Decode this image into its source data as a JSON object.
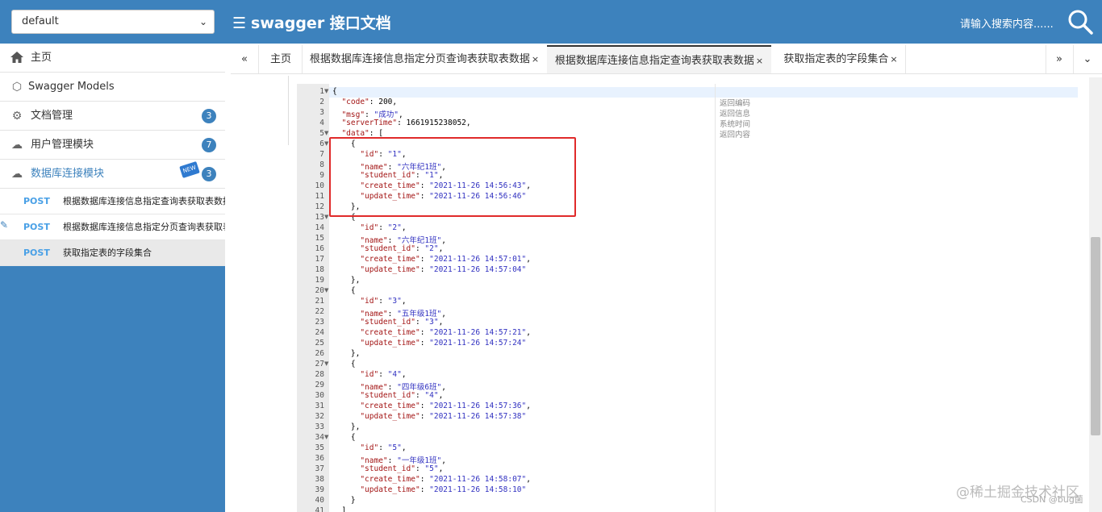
{
  "header": {
    "group_select": "default",
    "title": "swagger 接口文档",
    "search_placeholder": "请输入搜索内容......"
  },
  "sidebar": {
    "items": [
      {
        "label": "主页",
        "icon": "home-icon"
      },
      {
        "label": "Swagger Models",
        "icon": "cube-icon"
      },
      {
        "label": "文档管理",
        "icon": "doc-settings-icon",
        "badge": "3"
      },
      {
        "label": "用户管理模块",
        "icon": "cloud-icon",
        "badge": "7"
      },
      {
        "label": "数据库连接模块",
        "icon": "cloud-icon",
        "badge": "3",
        "tag": "NEW"
      }
    ],
    "apis": [
      {
        "method": "POST",
        "label": "根据数据库连接信息指定查询表获取表数据"
      },
      {
        "method": "POST",
        "label": "根据数据库连接信息指定分页查询表获取表数据"
      },
      {
        "method": "POST",
        "label": "获取指定表的字段集合"
      }
    ]
  },
  "tabs": {
    "home": "主页",
    "items": [
      {
        "label": "根据数据库连接信息指定分页查询表获取表数据"
      },
      {
        "label": "根据数据库连接信息指定查询表获取表数据"
      },
      {
        "label": "获取指定表的字段集合"
      }
    ],
    "close": "×"
  },
  "editor": {
    "lines": [
      "{",
      "  \"code\": 200,",
      "  \"msg\": \"成功\",",
      "  \"serverTime\": 1661915238052,",
      "  \"data\": [",
      "    {",
      "      \"id\": \"1\",",
      "      \"name\": \"六年纪1班\",",
      "      \"student_id\": \"1\",",
      "      \"create_time\": \"2021-11-26 14:56:43\",",
      "      \"update_time\": \"2021-11-26 14:56:46\"",
      "    },",
      "    {",
      "      \"id\": \"2\",",
      "      \"name\": \"六年纪1班\",",
      "      \"student_id\": \"2\",",
      "      \"create_time\": \"2021-11-26 14:57:01\",",
      "      \"update_time\": \"2021-11-26 14:57:04\"",
      "    },",
      "    {",
      "      \"id\": \"3\",",
      "      \"name\": \"五年级1班\",",
      "      \"student_id\": \"3\",",
      "      \"create_time\": \"2021-11-26 14:57:21\",",
      "      \"update_time\": \"2021-11-26 14:57:24\"",
      "    },",
      "    {",
      "      \"id\": \"4\",",
      "      \"name\": \"四年级6班\",",
      "      \"student_id\": \"4\",",
      "      \"create_time\": \"2021-11-26 14:57:36\",",
      "      \"update_time\": \"2021-11-26 14:57:38\"",
      "    },",
      "    {",
      "      \"id\": \"5\",",
      "      \"name\": \"一年级1班\",",
      "      \"student_id\": \"5\",",
      "      \"create_time\": \"2021-11-26 14:58:07\",",
      "      \"update_time\": \"2021-11-26 14:58:10\"",
      "    }",
      "  ]"
    ],
    "fold_lines": [
      1,
      5,
      6,
      13,
      20,
      27,
      34
    ],
    "descriptions": [
      "返回编码",
      "返回信息",
      "系统时间",
      "返回内容"
    ]
  },
  "watermark": "@稀土掘金技术社区",
  "csdn_mark": "CSDN @bug菌",
  "colors": {
    "header": "#3d82bd",
    "method": "#49a0e6",
    "highlight_box": "#e02a2a"
  }
}
